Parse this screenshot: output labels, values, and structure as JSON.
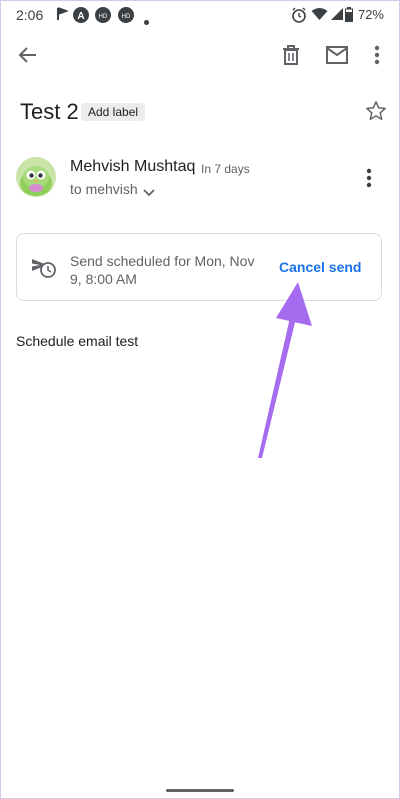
{
  "status_bar": {
    "time": "2:06",
    "battery": "72%",
    "icons": [
      "navigation-icon",
      "a-badge-icon",
      "hd-icon",
      "hd-icon",
      "dot-icon",
      "alarm-icon",
      "wifi-icon",
      "signal-icon",
      "battery-icon"
    ]
  },
  "toolbar": {
    "back": "arrow-back-icon",
    "delete": "trash-icon",
    "mark": "mail-icon",
    "more": "more-vert-icon"
  },
  "email": {
    "subject": "Test 2",
    "label_button": "Add label",
    "sender": {
      "name": "Mehvish Mushtaq",
      "time": "In 7 days",
      "recipient": "to mehvish"
    },
    "scheduled": {
      "text": "Send scheduled for Mon, Nov 9, 8:00 AM",
      "action": "Cancel send"
    },
    "body": "Schedule email test"
  },
  "colors": {
    "accent": "#1a73e8",
    "annotation_arrow": "#a66cf0"
  }
}
